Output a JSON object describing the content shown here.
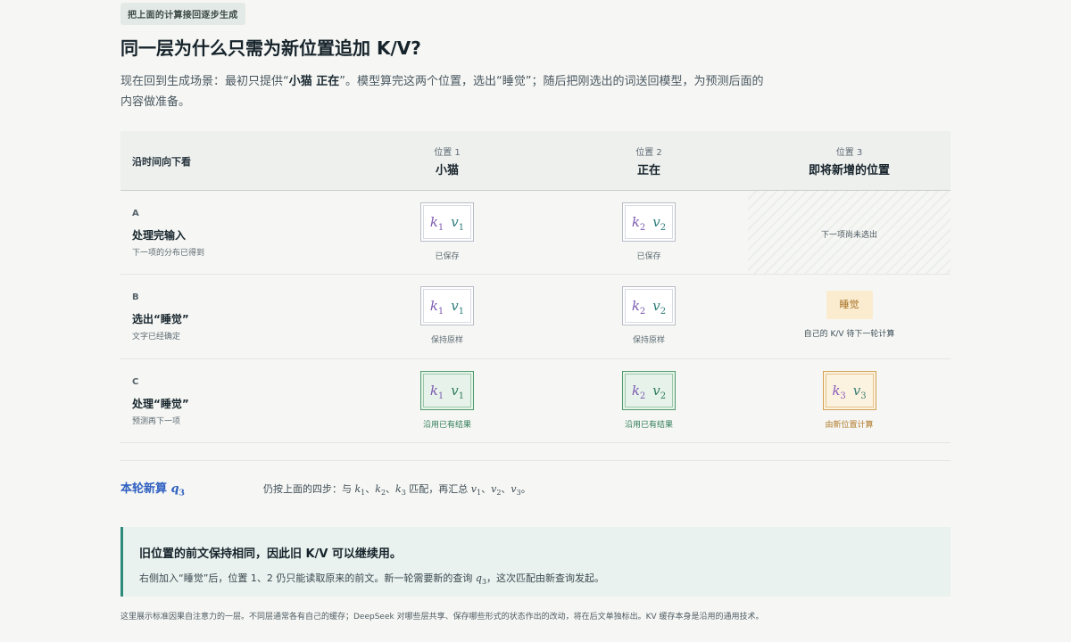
{
  "tag": "把上面的计算接回逐步生成",
  "title": "同一层为什么只需为新位置追加 K/V?",
  "intro": {
    "pre": "现在回到生成场景：最初只提供“",
    "bold": "小猫 正在",
    "post": "”。模型算完这两个位置，选出“睡觉”；随后把刚选出的词送回模型，为预测后面的内容做准备。"
  },
  "table": {
    "header_left": "沿时间向下看",
    "columns": [
      {
        "pos": "位置 1",
        "name": "小猫"
      },
      {
        "pos": "位置 2",
        "name": "正在"
      },
      {
        "pos": "位置 3",
        "name": "即将新增的位置"
      }
    ],
    "rows": [
      {
        "letter": "A",
        "title": "处理完输入",
        "sub": "下一项的分布已得到"
      },
      {
        "letter": "B",
        "title": "选出“睡觉”",
        "sub": "文字已经确定"
      },
      {
        "letter": "C",
        "title": "处理“睡觉”",
        "sub": "预测再下一项"
      }
    ],
    "captions": {
      "saved": "已保存",
      "keep": "保持原样",
      "reuse": "沿用已有结果",
      "new_calc": "由新位置计算",
      "not_selected": "下一项尚未选出",
      "chip": "睡觉",
      "chip_caption": "自己的 K/V 待下一轮计算"
    },
    "kv_letters": {
      "k": "k",
      "v": "v"
    },
    "kv_indices": [
      "1",
      "2",
      "3"
    ]
  },
  "query": {
    "label": "本轮新算",
    "symbol": "q",
    "index": "3",
    "text_pre": "仍按上面的四步：与",
    "sep1": "、",
    "text_mid": "匹配，再汇总",
    "text_end": "。"
  },
  "note": {
    "title": "旧位置的前文保持相同，因此旧 K/V 可以继续用。",
    "body_pre": "右侧加入“睡觉”后，位置 1、2 仍只能读取原来的前文。新一轮需要新的查询",
    "body_post": "，这次匹配由新查询发起。"
  },
  "footer": "这里展示标准因果自注意力的一层。不同层通常各有自己的缓存；DeepSeek 对哪些层共享、保存哪些形式的状态作出的改动，将在后文单独标出。KV 缓存本身是沿用的通用技术。",
  "colors": {
    "accent_blue": "#2f5fc0",
    "teal_border": "#2e8b7b",
    "reuse_green": "#4f9a6c",
    "new_orange": "#d3a055"
  }
}
